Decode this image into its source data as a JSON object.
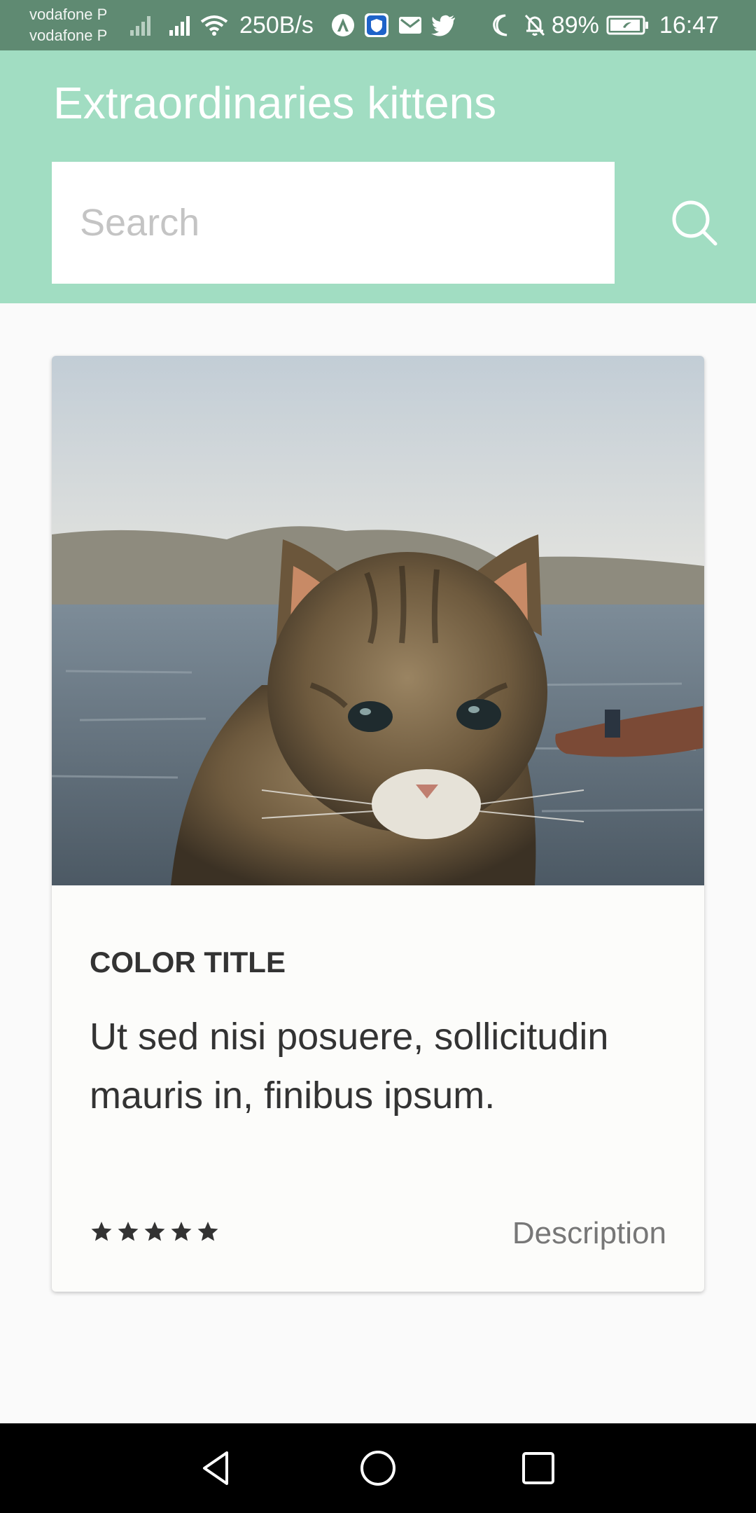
{
  "status_bar": {
    "carrier_1": "vodafone P",
    "carrier_2": "vodafone P",
    "net_speed": "250B/s",
    "battery": "89%",
    "time": "16:47"
  },
  "app": {
    "title": "Extraordinaries kittens",
    "accent_color": "#a1ddc2"
  },
  "search": {
    "placeholder": "Search",
    "value": "",
    "icon": "search-icon"
  },
  "card": {
    "image": "cat-photo-by-lake",
    "title": "COLOR TITLE",
    "text": "Ut sed nisi posuere, sollicitudin mauris in, finibus ipsum.",
    "rating": 5,
    "rating_max": 5,
    "link": "Description"
  },
  "nav": {
    "buttons": [
      "back-icon",
      "home-icon",
      "recents-icon"
    ]
  }
}
